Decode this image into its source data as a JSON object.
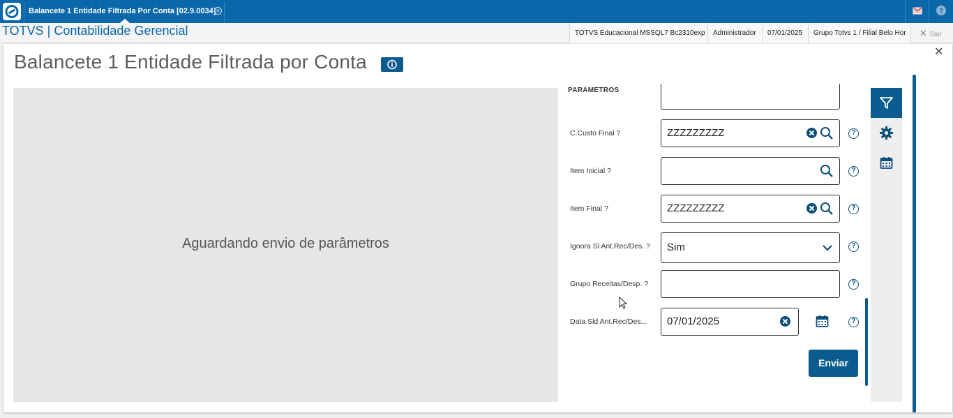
{
  "topbar": {
    "tab_title": "Balancete 1 Entidade Filtrada Por Conta [02.9.0034]",
    "tab_close": "✕"
  },
  "header": {
    "app_title": "TOTVS | Contabilidade Gerencial",
    "environment": "TOTVS Educacional MSSQL7 Bc2310exp",
    "user": "Administrador",
    "date": "07/01/2025",
    "branch": "Grupo Totvs 1 / Filial Belo Hor",
    "exit_label": "Sair"
  },
  "page": {
    "title": "Balancete 1 Entidade Filtrada por Conta",
    "close": "✕",
    "preview_message": "Aguardando envio de parâmetros",
    "params_heading": "PARAMETROS"
  },
  "fields": [
    {
      "label": "C.Custo Final ?",
      "value": "ZZZZZZZZZ"
    },
    {
      "label": "Item Inicial ?",
      "value": ""
    },
    {
      "label": "Item Final ?",
      "value": "ZZZZZZZZZ"
    },
    {
      "label": "Ignora Sl Ant.Rec/Des. ?",
      "value": "Sim"
    },
    {
      "label": "Grupo Receitas/Desp. ?",
      "value": ""
    },
    {
      "label": "Data Sld Ant.Rec/Des...",
      "value": "07/01/2025"
    }
  ],
  "help_glyph": "?",
  "submit_label": "Enviar",
  "icons": [
    "totvs-logo-icon",
    "mail-icon",
    "help-icon",
    "close-icon",
    "info-icon",
    "search-icon",
    "clear-icon",
    "chevron-down-icon",
    "calendar-icon",
    "filter-icon",
    "gear-icon"
  ],
  "colors": {
    "brand": "#0a67a9",
    "accent": "#0c5c8f",
    "preview_bg": "#e6e6e6"
  }
}
